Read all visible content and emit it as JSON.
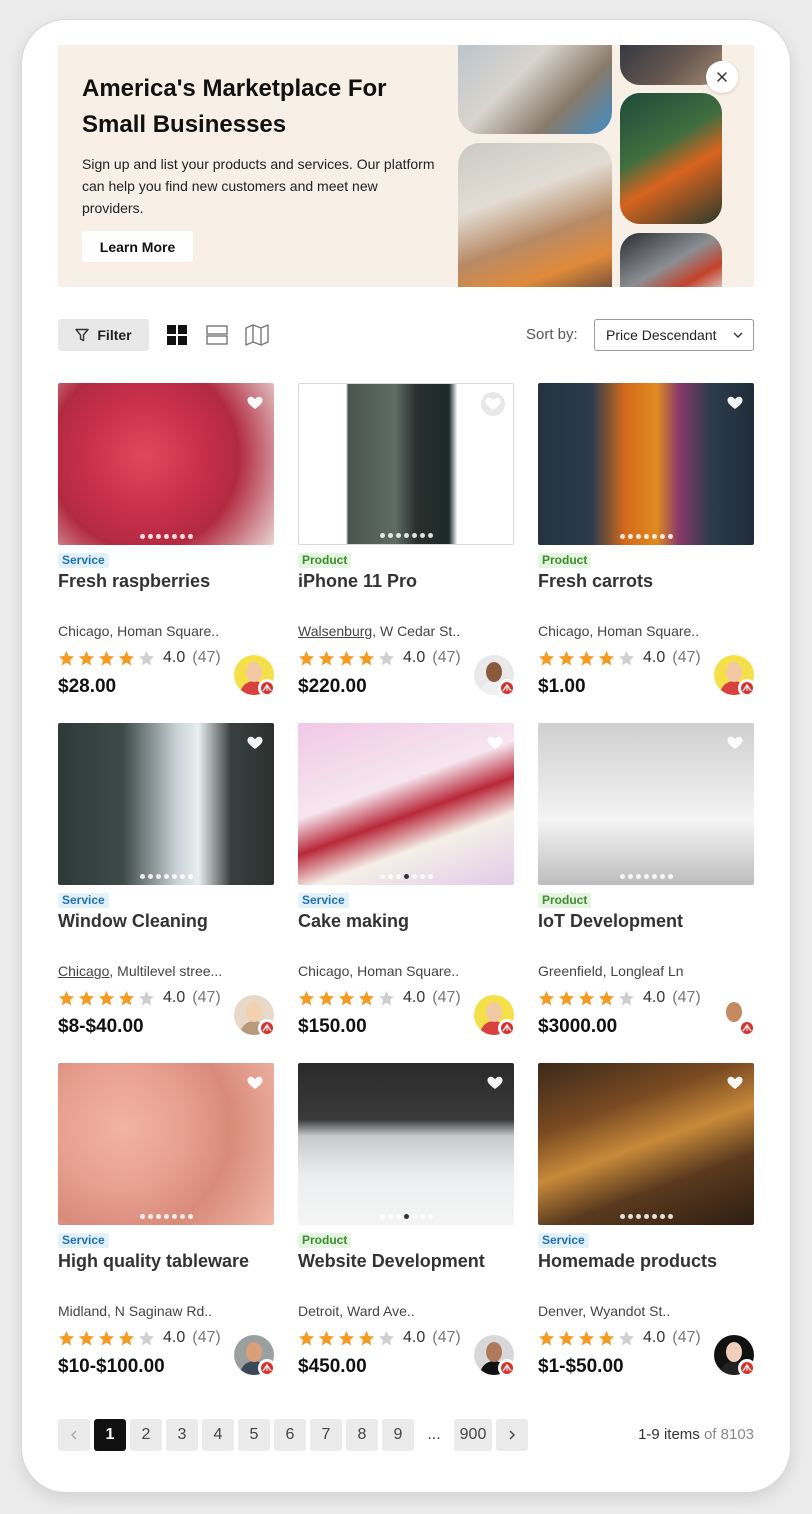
{
  "banner": {
    "title": "America's Marketplace For Small Businesses",
    "text": "Sign up and list your products and services. Our platform can help you find new customers and meet new providers.",
    "button": "Learn More"
  },
  "toolbar": {
    "filter_label": "Filter",
    "sort_label": "Sort by:",
    "sort_value": "Price Descendant",
    "views": [
      "grid-view-icon",
      "list-view-icon",
      "map-view-icon"
    ]
  },
  "colors": {
    "star_on": "#f59a23",
    "star_off": "#cfcfcf",
    "service_tag": "#1e73b8",
    "product_tag": "#3a8f2a"
  },
  "cards": [
    {
      "type": "Service",
      "title": "Fresh raspberries",
      "loc_a": "",
      "loc_b": "Chicago, Homan Square..",
      "rating": "4.0",
      "count": "(47)",
      "stars": 4,
      "price": "$28.00",
      "dots": 7,
      "active_dot": -1
    },
    {
      "type": "Product",
      "title": "iPhone 11 Pro",
      "loc_a": "Walsenburg",
      "loc_b": ", W Cedar St..",
      "rating": "4.0",
      "count": "(47)",
      "stars": 4,
      "price": "$220.00",
      "dots": 7,
      "active_dot": -1
    },
    {
      "type": "Product",
      "title": "Fresh carrots",
      "loc_a": "",
      "loc_b": "Chicago, Homan Square..",
      "rating": "4.0",
      "count": "(47)",
      "stars": 4,
      "price": "$1.00",
      "dots": 7,
      "active_dot": -1
    },
    {
      "type": "Service",
      "title": "Window Cleaning",
      "loc_a": "Chicago",
      "loc_b": ", Multilevel stree...",
      "rating": "4.0",
      "count": "(47)",
      "stars": 4,
      "price": "$8-$40.00",
      "dots": 7,
      "active_dot": -1
    },
    {
      "type": "Service",
      "title": "Cake making",
      "loc_a": "",
      "loc_b": "Chicago, Homan Square..",
      "rating": "4.0",
      "count": "(47)",
      "stars": 4,
      "price": "$150.00",
      "dots": 7,
      "active_dot": 3
    },
    {
      "type": "Product",
      "title": "IoT Development",
      "loc_a": "",
      "loc_b": "Greenfield, Longleaf Ln",
      "rating": "4.0",
      "count": "(47)",
      "stars": 4,
      "price": "$3000.00",
      "dots": 7,
      "active_dot": -1
    },
    {
      "type": "Service",
      "title": "High quality tableware",
      "loc_a": "",
      "loc_b": "Midland, N Saginaw Rd..",
      "rating": "4.0",
      "count": "(47)",
      "stars": 4,
      "price": "$10-$100.00",
      "dots": 7,
      "active_dot": -1
    },
    {
      "type": "Product",
      "title": "Website Development",
      "loc_a": "",
      "loc_b": "Detroit, Ward Ave..",
      "rating": "4.0",
      "count": "(47)",
      "stars": 4,
      "price": "$450.00",
      "dots": 7,
      "active_dot": 3
    },
    {
      "type": "Service",
      "title": "Homemade products",
      "loc_a": "",
      "loc_b": "Denver, Wyandot St..",
      "rating": "4.0",
      "count": "(47)",
      "stars": 4,
      "price": "$1-$50.00",
      "dots": 7,
      "active_dot": -1
    }
  ],
  "pagination": {
    "pages": [
      "1",
      "2",
      "3",
      "4",
      "5",
      "6",
      "7",
      "8",
      "9"
    ],
    "ellipsis": "...",
    "last": "900",
    "active": "1",
    "range": "1-9 items",
    "total": "of 8103"
  }
}
